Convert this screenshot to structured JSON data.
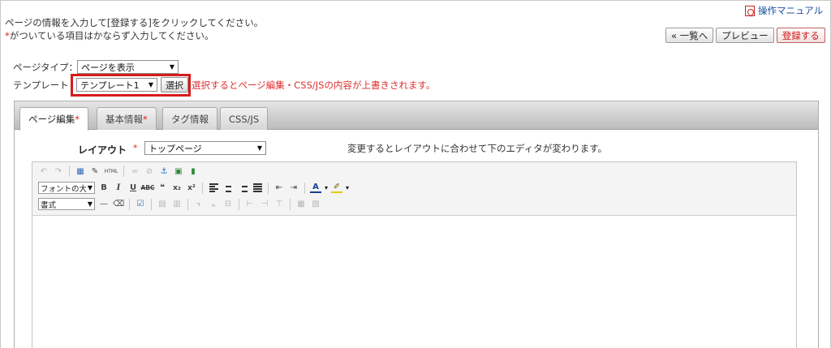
{
  "header": {
    "manual_link": "操作マニュアル",
    "instruction_line1": "ページの情報を入力して[登録する]をクリックしてください。",
    "required_mark": "*",
    "instruction_line2": "がついている項目はかならず入力してください。"
  },
  "actions": {
    "back_label": "« 一覧へ",
    "preview_label": "プレビュー",
    "register_label": "登録する"
  },
  "form": {
    "page_type_label": "ページタイプ：",
    "page_type_value": "ページを表示",
    "template_label": "テンプレート",
    "template_value": "テンプレート1",
    "select_button": "選択",
    "template_warning": "選択するとページ編集・CSS/JSの内容が上書きされます。"
  },
  "tabs": [
    {
      "label": "ページ編集",
      "required": "*",
      "active": true
    },
    {
      "label": "基本情報",
      "required": "*",
      "active": false
    },
    {
      "label": "タグ情報",
      "required": "",
      "active": false
    },
    {
      "label": "CSS/JS",
      "required": "",
      "active": false
    }
  ],
  "layout": {
    "label": "レイアウト",
    "required": "*",
    "value": "トップページ",
    "hint": "変更するとレイアウトに合わせて下のエディタが変わります。"
  },
  "editor": {
    "font_size_select": "フォントの大きさ",
    "format_select": "書式",
    "html_icon_text": "HTML",
    "bold_glyph": "B",
    "italic_glyph": "I",
    "underline_glyph": "U",
    "strike_glyph": "ABC",
    "quote_glyph": "❝",
    "subscript_glyph": "x₂",
    "superscript_glyph": "x²",
    "font_color_glyph": "A",
    "hr_glyph": "—"
  },
  "colors": {
    "accent_red": "#d51c1c",
    "link_blue": "#1a4f9c"
  }
}
